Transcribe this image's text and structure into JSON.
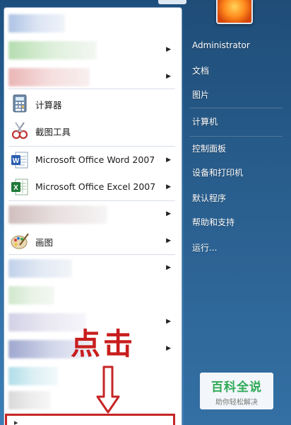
{
  "user": {
    "name": "Administrator"
  },
  "right_menu": [
    {
      "label": "文档"
    },
    {
      "label": "图片"
    },
    {
      "label": "计算机"
    },
    {
      "label": "控制面板"
    },
    {
      "label": "设备和打印机"
    },
    {
      "label": "默认程序"
    },
    {
      "label": "帮助和支持"
    },
    {
      "label": "运行..."
    }
  ],
  "left_menu": {
    "calculator": "计算器",
    "snipping_tool": "截图工具",
    "word": "Microsoft Office Word 2007",
    "excel": "Microsoft Office Excel 2007",
    "paint": "画图"
  },
  "annotation": {
    "text": "点击"
  },
  "watermark": {
    "title": "百科全说",
    "subtitle": "助你轻松解决"
  },
  "colors": {
    "annotation_red": "#c81d1d",
    "watermark_green": "#2faa57"
  }
}
